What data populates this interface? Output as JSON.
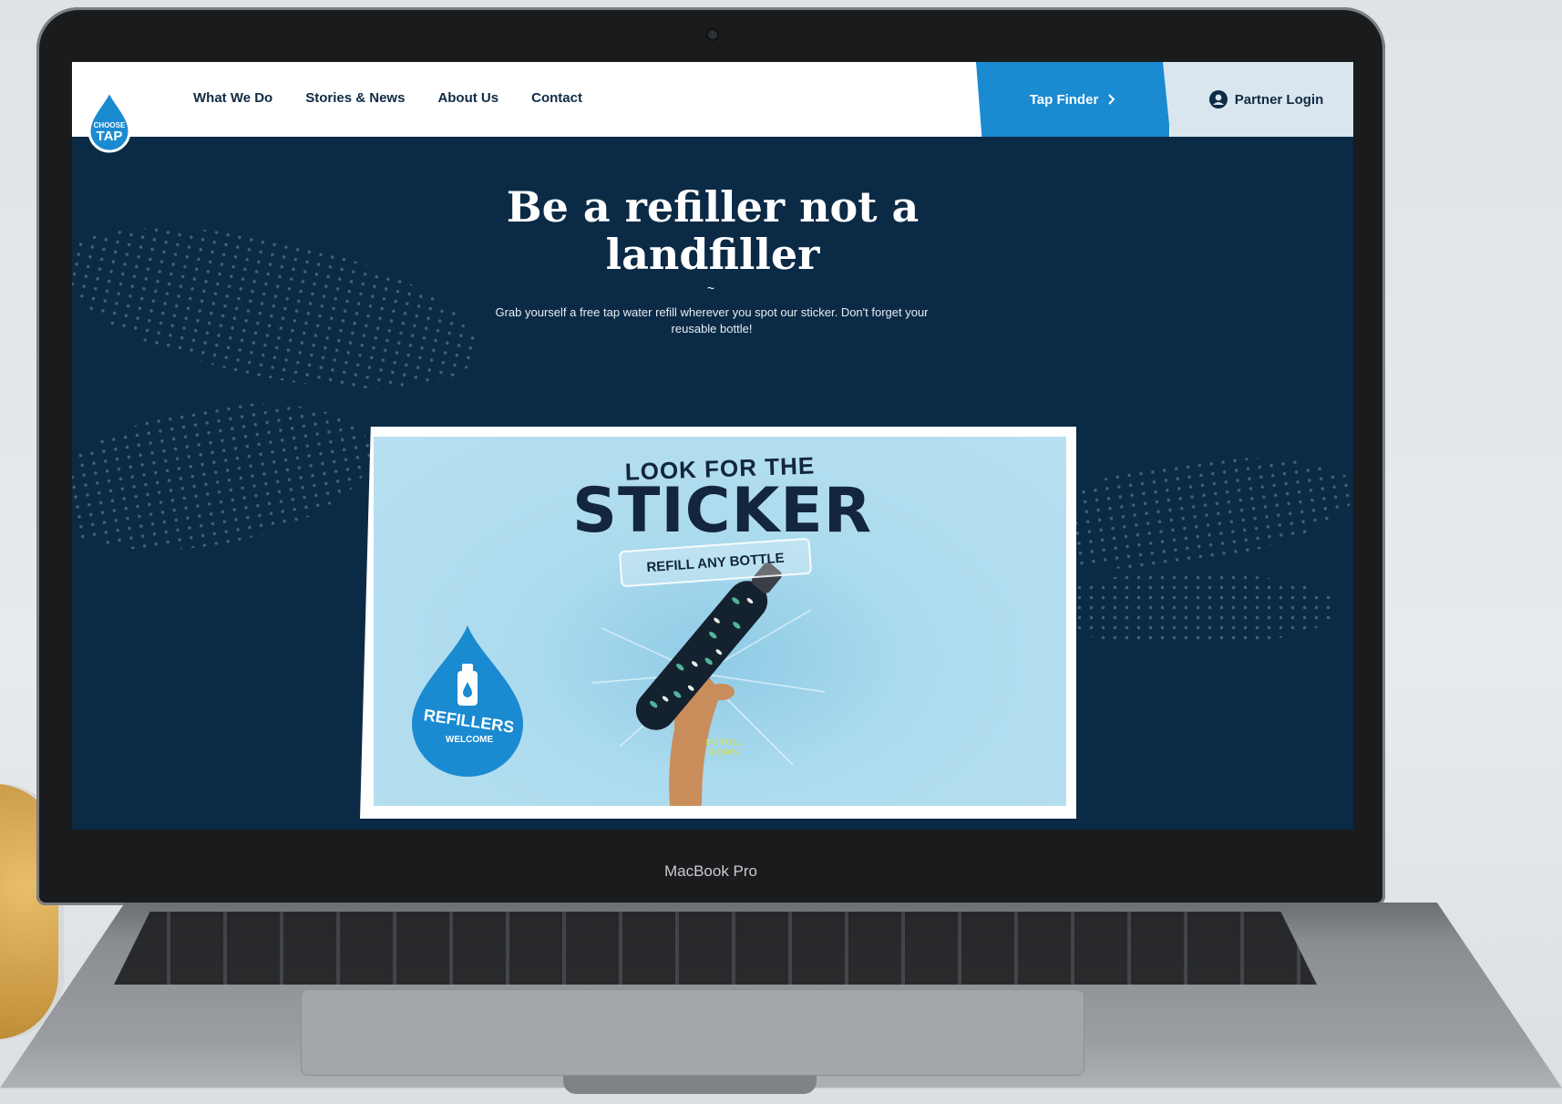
{
  "nav": {
    "logo_text_top": "CHOOSE",
    "logo_text_bottom": "TAP",
    "links": [
      "What We Do",
      "Stories & News",
      "About Us",
      "Contact"
    ],
    "tap_finder": "Tap Finder",
    "partner_login": "Partner Login"
  },
  "hero": {
    "title": "Be a refiller not a landfiller",
    "tilde": "~",
    "subtitle": "Grab yourself a free tap water refill wherever you spot our sticker. Don't forget your reusable bottle!"
  },
  "banner": {
    "look_for": "LOOK FOR THE",
    "sticker": "STICKER",
    "ribbon": "REFILL ANY BOTTLE",
    "refillers": "REFILLERS",
    "welcome": "WELCOME",
    "scroll": "SCROLL DOWN"
  },
  "device": {
    "label": "MacBook Pro"
  },
  "colors": {
    "navy": "#0b2a45",
    "blue": "#1a8ad1",
    "light": "#d9e6ee",
    "sky": "#b8e0f0"
  }
}
